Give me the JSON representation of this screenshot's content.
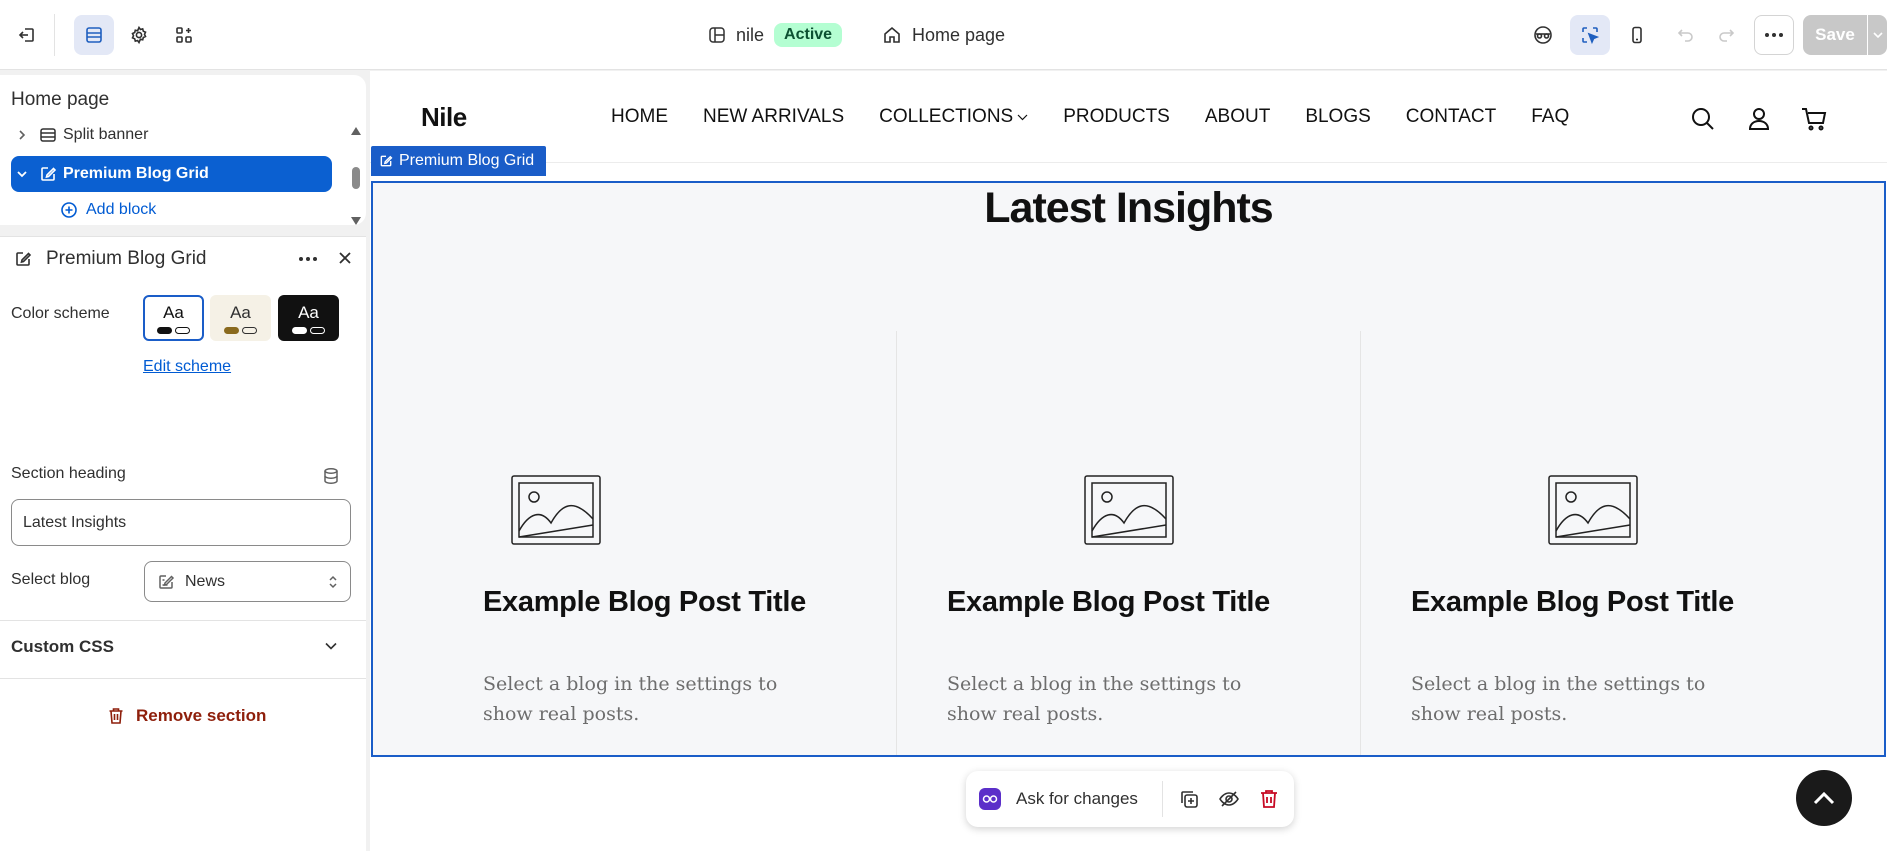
{
  "topbar": {
    "store_name": "nile",
    "store_status": "Active",
    "page_name": "Home page",
    "save_label": "Save"
  },
  "sidebar": {
    "tree_title": "Home page",
    "tree_items": [
      {
        "label": "Split banner",
        "selected": false
      },
      {
        "label": "Premium Blog Grid",
        "selected": true
      }
    ],
    "add_block_label": "Add block",
    "settings": {
      "title": "Premium Blog Grid",
      "color_scheme_label": "Color scheme",
      "schemes": [
        {
          "sample": "Aa",
          "bg": "#ffffff",
          "fg": "#111111",
          "selected": true
        },
        {
          "sample": "Aa",
          "bg": "#f5f1e6",
          "fg": "#303030",
          "selected": false
        },
        {
          "sample": "Aa",
          "bg": "#111111",
          "fg": "#ffffff",
          "selected": false
        }
      ],
      "edit_scheme_label": "Edit scheme",
      "section_heading_label": "Section heading",
      "section_heading_value": "Latest Insights",
      "select_blog_label": "Select blog",
      "select_blog_value": "News",
      "custom_css_label": "Custom CSS",
      "remove_section_label": "Remove section"
    }
  },
  "preview": {
    "store_logo": "Nile",
    "nav": [
      "HOME",
      "NEW ARRIVALS",
      "COLLECTIONS",
      "PRODUCTS",
      "ABOUT",
      "BLOGS",
      "CONTACT",
      "FAQ"
    ],
    "section_tag": "Premium Blog Grid",
    "section_heading": "Latest Insights",
    "posts": [
      {
        "title": "Example Blog Post Title",
        "excerpt": "Select a blog in the settings to show real posts."
      },
      {
        "title": "Example Blog Post Title",
        "excerpt": "Select a blog in the settings to show real posts."
      },
      {
        "title": "Example Blog Post Title",
        "excerpt": "Select a blog in the settings to show real posts."
      }
    ],
    "ask_label": "Ask for changes"
  },
  "colors": {
    "accent": "#0b60d1",
    "section_outline": "#1a5dc8",
    "active_badge_bg": "#b4fed2",
    "danger": "#8e1f0b"
  }
}
